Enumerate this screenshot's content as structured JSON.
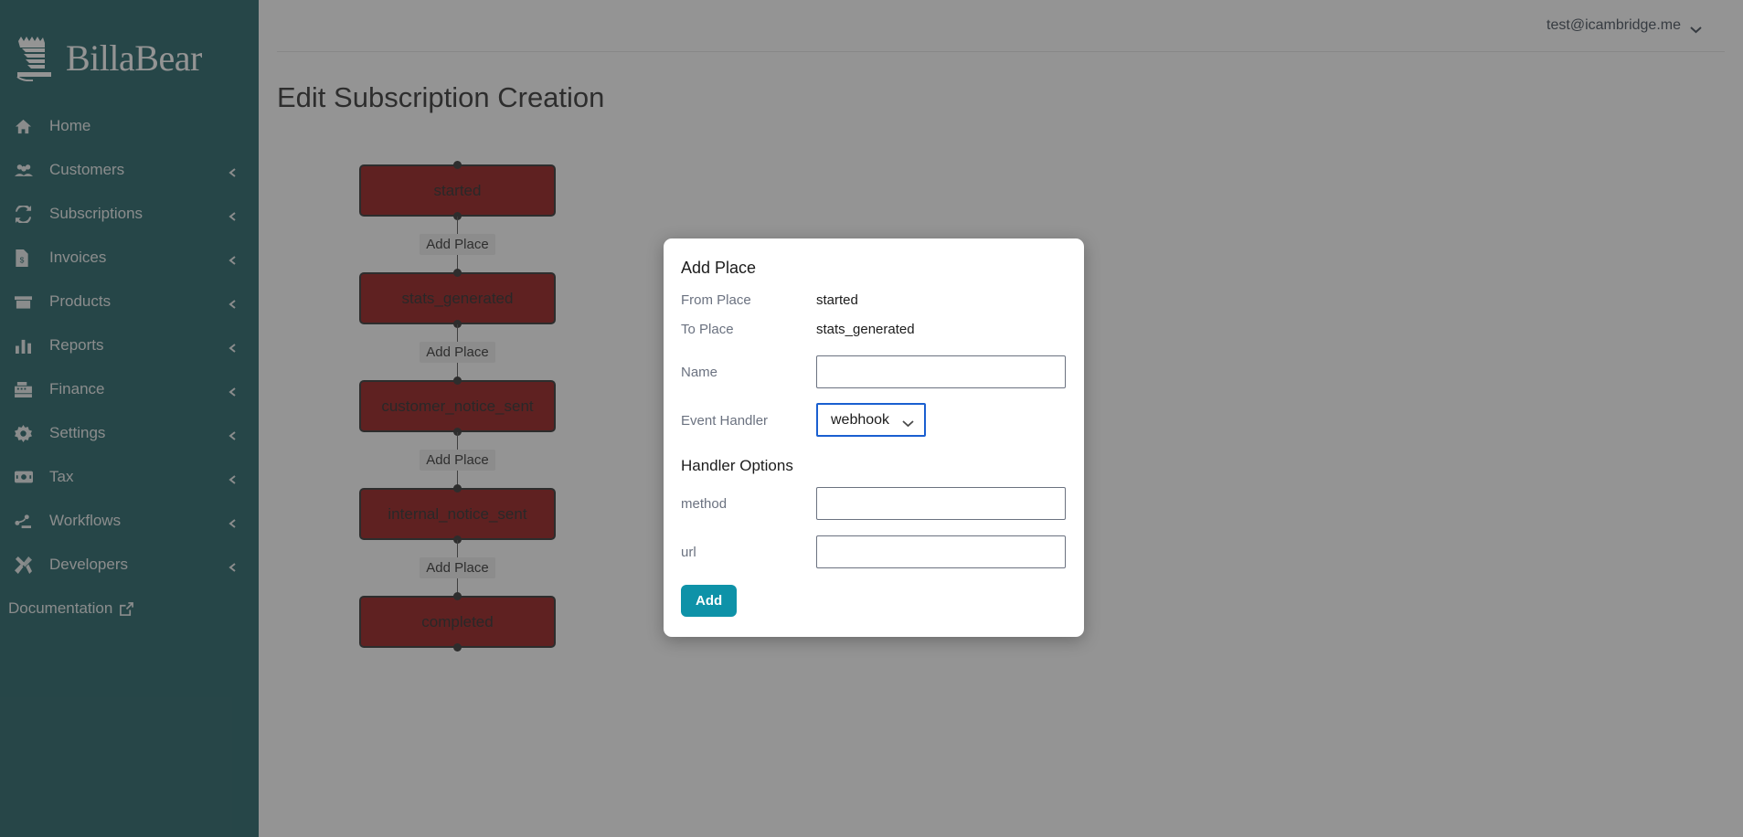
{
  "brand": {
    "name": "BillaBear",
    "logo_icon": "billabear-bear-logo"
  },
  "sidebar": {
    "items": [
      {
        "label": "Home",
        "icon": "home-icon",
        "has_chevron": false
      },
      {
        "label": "Customers",
        "icon": "users-icon",
        "has_chevron": true
      },
      {
        "label": "Subscriptions",
        "icon": "refresh-cycle-icon",
        "has_chevron": true
      },
      {
        "label": "Invoices",
        "icon": "invoice-doc-icon",
        "has_chevron": true
      },
      {
        "label": "Products",
        "icon": "box-icon",
        "has_chevron": true
      },
      {
        "label": "Reports",
        "icon": "bar-chart-icon",
        "has_chevron": true
      },
      {
        "label": "Finance",
        "icon": "cash-register-icon",
        "has_chevron": true
      },
      {
        "label": "Settings",
        "icon": "gear-icon",
        "has_chevron": true
      },
      {
        "label": "Tax",
        "icon": "banknote-icon",
        "has_chevron": true
      },
      {
        "label": "Workflows",
        "icon": "workflow-icon",
        "has_chevron": true
      },
      {
        "label": "Developers",
        "icon": "tools-icon",
        "has_chevron": true
      }
    ],
    "documentation": {
      "label": "Documentation",
      "icon": "external-link-icon"
    }
  },
  "topbar": {
    "user_email": "test@icambridge.me",
    "chevron_icon": "chevron-down-icon"
  },
  "page": {
    "title": "Edit Subscription Creation"
  },
  "workflow": {
    "node_color": "#8b0000",
    "edge_label": "Add Place",
    "nodes": [
      {
        "label": "started"
      },
      {
        "label": "stats_generated"
      },
      {
        "label": "customer_notice_sent"
      },
      {
        "label": "internal_notice_sent"
      },
      {
        "label": "completed"
      }
    ],
    "edges": [
      {
        "label": "Add Place"
      },
      {
        "label": "Add Place"
      },
      {
        "label": "Add Place"
      },
      {
        "label": "Add Place"
      }
    ]
  },
  "modal": {
    "title": "Add Place",
    "from_place_label": "From Place",
    "from_place_value": "started",
    "to_place_label": "To Place",
    "to_place_value": "stats_generated",
    "name_label": "Name",
    "name_value": "",
    "name_placeholder": "",
    "event_handler_label": "Event Handler",
    "event_handler_value": "webhook",
    "event_handler_chevron": "chevron-down-icon",
    "handler_options_heading": "Handler Options",
    "options": [
      {
        "label": "method",
        "value": "",
        "placeholder": ""
      },
      {
        "label": "url",
        "value": "",
        "placeholder": ""
      }
    ],
    "submit_label": "Add",
    "accent_color": "#0e92a8",
    "focus_color": "#1a5fd0"
  }
}
